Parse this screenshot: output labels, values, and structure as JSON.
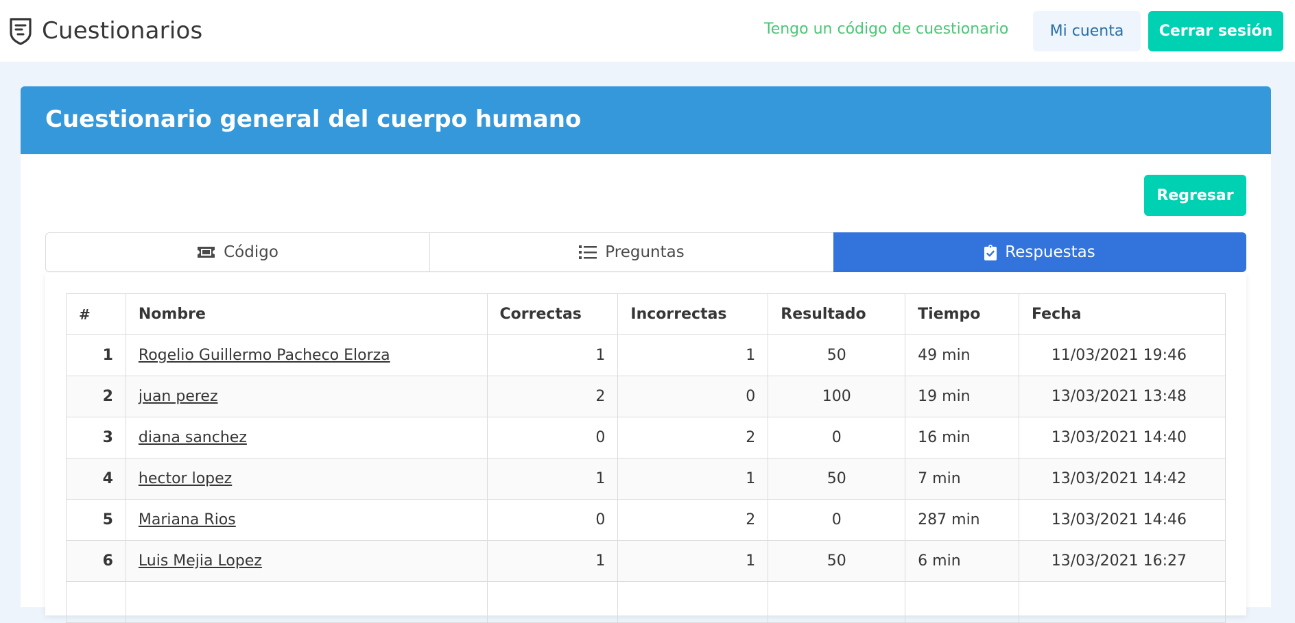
{
  "navbar": {
    "brand": "Cuestionarios",
    "code_link": "Tengo un código de cuestionario",
    "account_label": "Mi cuenta",
    "logout_label": "Cerrar sesión"
  },
  "card": {
    "title": "Cuestionario general del cuerpo humano",
    "back_label": "Regresar"
  },
  "tabs": [
    {
      "label": "Código",
      "icon": "ticket-icon",
      "active": false
    },
    {
      "label": "Preguntas",
      "icon": "list-icon",
      "active": false
    },
    {
      "label": "Respuestas",
      "icon": "clipboard-check-icon",
      "active": true
    }
  ],
  "table": {
    "headers": [
      "#",
      "Nombre",
      "Correctas",
      "Incorrectas",
      "Resultado",
      "Tiempo",
      "Fecha"
    ],
    "rows": [
      {
        "num": "1",
        "name": "Rogelio Guillermo Pacheco Elorza",
        "correct": "1",
        "incorrect": "1",
        "result": "50",
        "time": "49 min",
        "date": "11/03/2021 19:46"
      },
      {
        "num": "2",
        "name": "juan perez",
        "correct": "2",
        "incorrect": "0",
        "result": "100",
        "time": "19 min",
        "date": "13/03/2021 13:48"
      },
      {
        "num": "3",
        "name": "diana sanchez",
        "correct": "0",
        "incorrect": "2",
        "result": "0",
        "time": "16 min",
        "date": "13/03/2021 14:40"
      },
      {
        "num": "4",
        "name": "hector lopez",
        "correct": "1",
        "incorrect": "1",
        "result": "50",
        "time": "7 min",
        "date": "13/03/2021 14:42"
      },
      {
        "num": "5",
        "name": "Mariana Rios",
        "correct": "0",
        "incorrect": "2",
        "result": "0",
        "time": "287 min",
        "date": "13/03/2021 14:46"
      },
      {
        "num": "6",
        "name": "Luis Mejia Lopez",
        "correct": "1",
        "incorrect": "1",
        "result": "50",
        "time": "6 min",
        "date": "13/03/2021 16:27"
      },
      {
        "num": "",
        "name": "",
        "correct": "",
        "incorrect": "",
        "result": "",
        "time": "",
        "date": ""
      }
    ]
  },
  "colors": {
    "primary": "#3273dc",
    "header": "#3498db",
    "turquoise": "#00d1b2",
    "success": "#48c774",
    "background": "#edf4fb"
  }
}
